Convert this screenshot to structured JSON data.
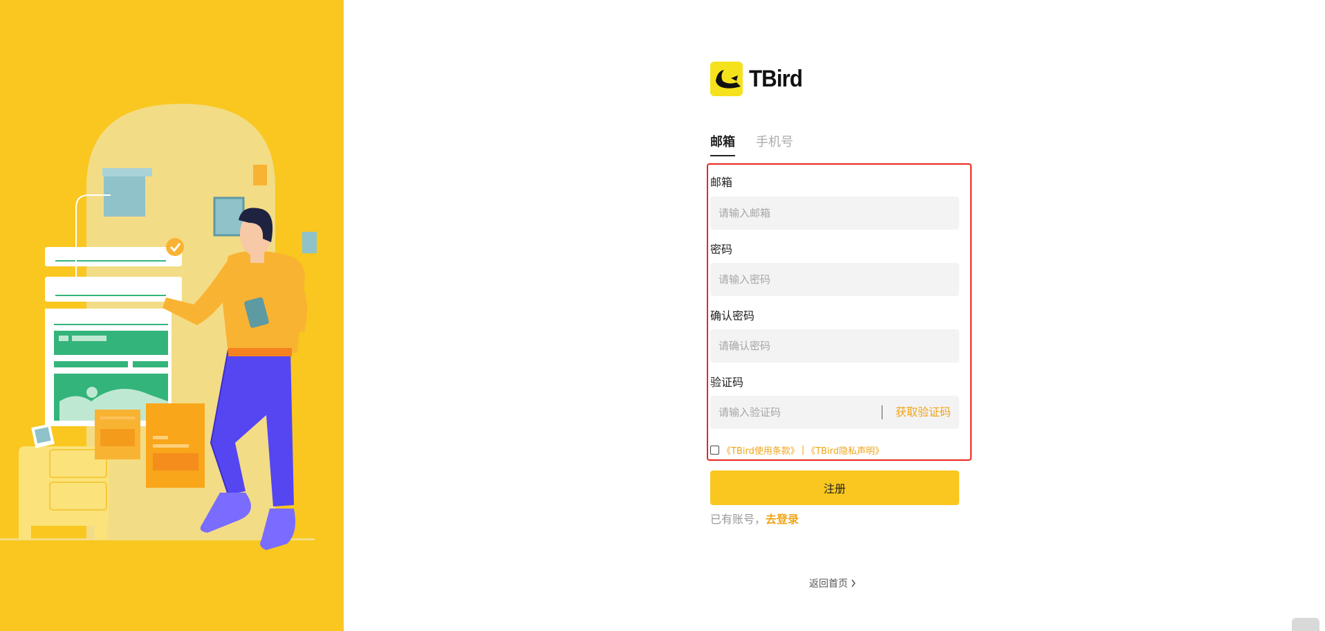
{
  "brand": {
    "name": "TBird"
  },
  "tabs": [
    {
      "label": "邮箱",
      "active": true
    },
    {
      "label": "手机号",
      "active": false
    }
  ],
  "form": {
    "email": {
      "label": "邮箱",
      "placeholder": "请输入邮箱",
      "value": ""
    },
    "password": {
      "label": "密码",
      "placeholder": "请输入密码",
      "value": ""
    },
    "confirm_password": {
      "label": "确认密码",
      "placeholder": "请确认密码",
      "value": ""
    },
    "code": {
      "label": "验证码",
      "placeholder": "请输入验证码",
      "value": "",
      "get_code_label": "获取验证码"
    },
    "agreement": {
      "checked": false,
      "terms_link": "《TBird使用条款》",
      "separator": "|",
      "privacy_link": "《TBird隐私声明》"
    }
  },
  "submit": {
    "label": "注册"
  },
  "login_prompt": {
    "prefix": "已有账号，",
    "link": "去登录"
  },
  "back_home": {
    "label": "返回首页",
    "icon": "chevron-right-icon"
  },
  "colors": {
    "accent": "#f9c71f",
    "link": "#f0a418",
    "highlight_border": "#e8251e"
  }
}
